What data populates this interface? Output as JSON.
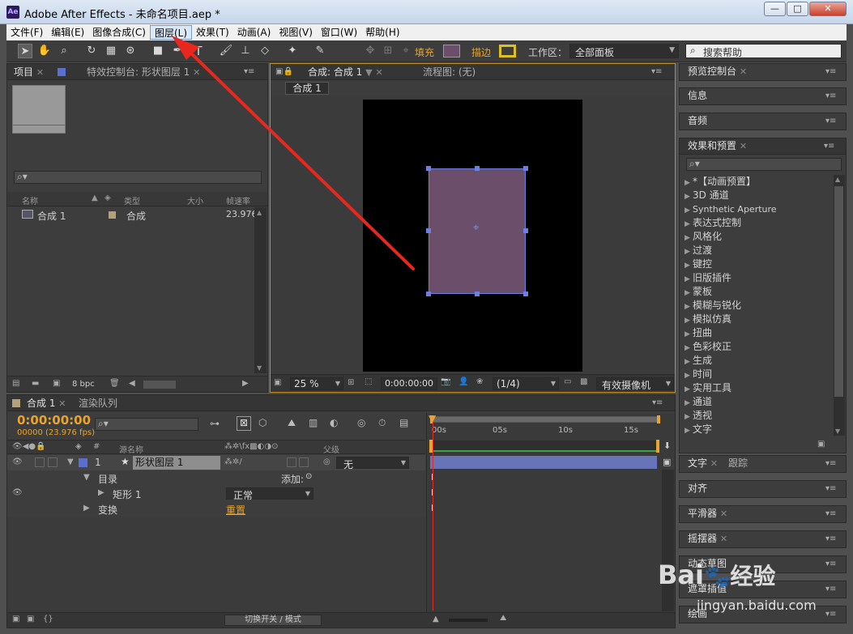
{
  "window": {
    "title": "Adobe After Effects - 未命名项目.aep *",
    "app_icon": "Ae",
    "min": "—",
    "max": "□",
    "close": "✕"
  },
  "menu": [
    "文件(F)",
    "编辑(E)",
    "图像合成(C)",
    "图层(L)",
    "效果(T)",
    "动画(A)",
    "视图(V)",
    "窗口(W)",
    "帮助(H)"
  ],
  "toolbar": {
    "fill_label": "填充",
    "stroke_label": "描边",
    "workspace_label": "工作区：",
    "workspace_value": "全部面板",
    "search_placeholder": "搜索帮助",
    "fill_color": "#6b4f6a",
    "stroke_color": "#e0c020"
  },
  "project_panel": {
    "tab_project": "项目",
    "tab_effects": "特效控制台: 形状图层 1",
    "columns": [
      "名称",
      "类型",
      "大小",
      "帧速率"
    ],
    "rows": [
      {
        "name": "合成 1",
        "type": "合成",
        "size": "",
        "fps": "23.976"
      }
    ],
    "bpc": "8 bpc"
  },
  "comp_panel": {
    "tab_comp": "合成: 合成 1",
    "tab_flow": "流程图: (无)",
    "sub_tab": "合成 1",
    "zoom": "25 %",
    "time": "0:00:00:00",
    "resolution": "(1/4)",
    "camera": "有效摄像机",
    "shape_fill": "#6b4f6a"
  },
  "right_panels": {
    "preview": "预览控制台",
    "info": "信息",
    "audio": "音频",
    "effects": "效果和预置",
    "effects_list": [
      "*【动画预置】",
      "3D 通道",
      "Synthetic Aperture",
      "表达式控制",
      "风格化",
      "过渡",
      "键控",
      "旧版插件",
      "蒙板",
      "模糊与锐化",
      "模拟仿真",
      "扭曲",
      "色彩校正",
      "生成",
      "时间",
      "实用工具",
      "通道",
      "透视",
      "文字"
    ],
    "text_tab": "文字",
    "track_tab": "跟踪",
    "align": "对齐",
    "smoother": "平滑器",
    "wiggler": "摇摆器",
    "motion_sketch": "动态草图",
    "mask_interp": "遮罩插值",
    "paint": "绘画"
  },
  "timeline": {
    "tab_comp": "合成 1",
    "tab_render": "渲染队列",
    "timecode": "0:00:00:00",
    "fps_info": "00000 (23.976 fps)",
    "col_source": "源名称",
    "col_parent": "父级",
    "ruler": [
      "00s",
      "05s",
      "10s",
      "15s"
    ],
    "layer": {
      "num": "1",
      "name": "形状图层 1",
      "parent": "无"
    },
    "contents": "目录",
    "add": "添加:",
    "rect": "矩形 1",
    "blend": "正常",
    "transform": "变换",
    "reset": "重置",
    "footer": "切换开关 / 模式"
  },
  "watermark": {
    "brand": "Bai",
    "brand2": "经验",
    "url": "jingyan.baidu.com"
  },
  "arrow_color": "#e8281e"
}
